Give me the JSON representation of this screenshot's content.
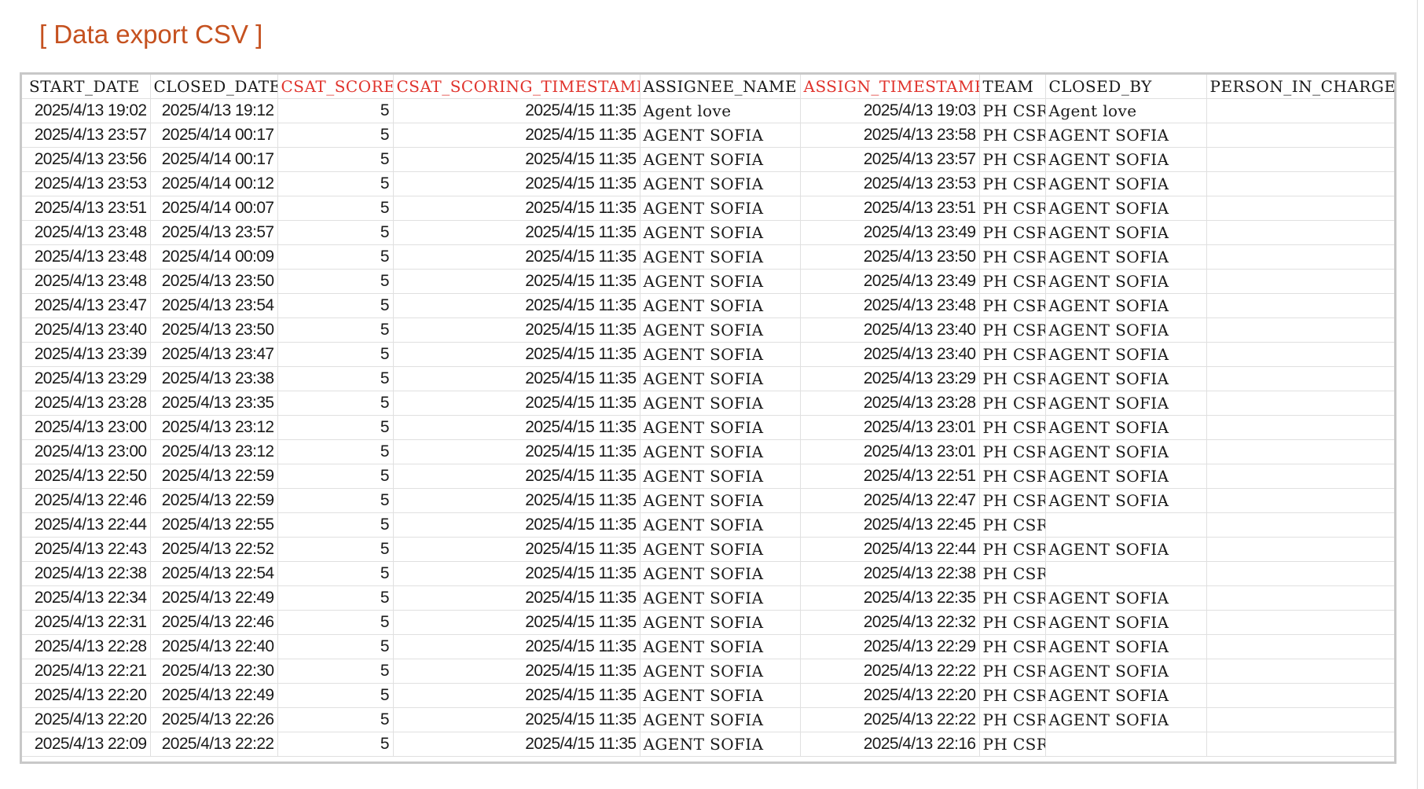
{
  "title": "[ Data export CSV ]",
  "colors": {
    "title": "#c5511f",
    "highlighted_header": "#e0332c",
    "text": "#1a1a1a",
    "grid": "#e0e0e0"
  },
  "table": {
    "columns": [
      {
        "label": "START_DATE",
        "highlighted": false
      },
      {
        "label": "CLOSED_DATE",
        "highlighted": false
      },
      {
        "label": "CSAT_SCORE",
        "highlighted": true
      },
      {
        "label": "CSAT_SCORING_TIMESTAMP",
        "highlighted": true
      },
      {
        "label": "ASSIGNEE_NAME",
        "highlighted": false
      },
      {
        "label": "ASSIGN_TIMESTAMP",
        "highlighted": true
      },
      {
        "label": "TEAM",
        "highlighted": false
      },
      {
        "label": "CLOSED_BY",
        "highlighted": false
      },
      {
        "label": "PERSON_IN_CHARGE",
        "highlighted": false
      }
    ],
    "rows": [
      [
        "2025/4/13 19:02",
        "2025/4/13 19:12",
        "5",
        "2025/4/15 11:35",
        "Agent love",
        "2025/4/13 19:03",
        "PH CSR",
        "Agent love",
        ""
      ],
      [
        "2025/4/13 23:57",
        "2025/4/14 00:17",
        "5",
        "2025/4/15 11:35",
        "AGENT SOFIA",
        "2025/4/13 23:58",
        "PH CSR",
        "AGENT SOFIA",
        ""
      ],
      [
        "2025/4/13 23:56",
        "2025/4/14 00:17",
        "5",
        "2025/4/15 11:35",
        "AGENT SOFIA",
        "2025/4/13 23:57",
        "PH CSR",
        "AGENT SOFIA",
        ""
      ],
      [
        "2025/4/13 23:53",
        "2025/4/14 00:12",
        "5",
        "2025/4/15 11:35",
        "AGENT SOFIA",
        "2025/4/13 23:53",
        "PH CSR",
        "AGENT SOFIA",
        ""
      ],
      [
        "2025/4/13 23:51",
        "2025/4/14 00:07",
        "5",
        "2025/4/15 11:35",
        "AGENT SOFIA",
        "2025/4/13 23:51",
        "PH CSR",
        "AGENT SOFIA",
        ""
      ],
      [
        "2025/4/13 23:48",
        "2025/4/13 23:57",
        "5",
        "2025/4/15 11:35",
        "AGENT SOFIA",
        "2025/4/13 23:49",
        "PH CSR",
        "AGENT SOFIA",
        ""
      ],
      [
        "2025/4/13 23:48",
        "2025/4/14 00:09",
        "5",
        "2025/4/15 11:35",
        "AGENT SOFIA",
        "2025/4/13 23:50",
        "PH CSR",
        "AGENT SOFIA",
        ""
      ],
      [
        "2025/4/13 23:48",
        "2025/4/13 23:50",
        "5",
        "2025/4/15 11:35",
        "AGENT SOFIA",
        "2025/4/13 23:49",
        "PH CSR",
        "AGENT SOFIA",
        ""
      ],
      [
        "2025/4/13 23:47",
        "2025/4/13 23:54",
        "5",
        "2025/4/15 11:35",
        "AGENT SOFIA",
        "2025/4/13 23:48",
        "PH CSR",
        "AGENT SOFIA",
        ""
      ],
      [
        "2025/4/13 23:40",
        "2025/4/13 23:50",
        "5",
        "2025/4/15 11:35",
        "AGENT SOFIA",
        "2025/4/13 23:40",
        "PH CSR",
        "AGENT SOFIA",
        ""
      ],
      [
        "2025/4/13 23:39",
        "2025/4/13 23:47",
        "5",
        "2025/4/15 11:35",
        "AGENT SOFIA",
        "2025/4/13 23:40",
        "PH CSR",
        "AGENT SOFIA",
        ""
      ],
      [
        "2025/4/13 23:29",
        "2025/4/13 23:38",
        "5",
        "2025/4/15 11:35",
        "AGENT SOFIA",
        "2025/4/13 23:29",
        "PH CSR",
        "AGENT SOFIA",
        ""
      ],
      [
        "2025/4/13 23:28",
        "2025/4/13 23:35",
        "5",
        "2025/4/15 11:35",
        "AGENT SOFIA",
        "2025/4/13 23:28",
        "PH CSR",
        "AGENT SOFIA",
        ""
      ],
      [
        "2025/4/13 23:00",
        "2025/4/13 23:12",
        "5",
        "2025/4/15 11:35",
        "AGENT SOFIA",
        "2025/4/13 23:01",
        "PH CSR",
        "AGENT SOFIA",
        ""
      ],
      [
        "2025/4/13 23:00",
        "2025/4/13 23:12",
        "5",
        "2025/4/15 11:35",
        "AGENT SOFIA",
        "2025/4/13 23:01",
        "PH CSR",
        "AGENT SOFIA",
        ""
      ],
      [
        "2025/4/13 22:50",
        "2025/4/13 22:59",
        "5",
        "2025/4/15 11:35",
        "AGENT SOFIA",
        "2025/4/13 22:51",
        "PH CSR",
        "AGENT SOFIA",
        ""
      ],
      [
        "2025/4/13 22:46",
        "2025/4/13 22:59",
        "5",
        "2025/4/15 11:35",
        "AGENT SOFIA",
        "2025/4/13 22:47",
        "PH CSR",
        "AGENT SOFIA",
        ""
      ],
      [
        "2025/4/13 22:44",
        "2025/4/13 22:55",
        "5",
        "2025/4/15 11:35",
        "AGENT SOFIA",
        "2025/4/13 22:45",
        "PH CSR",
        "",
        ""
      ],
      [
        "2025/4/13 22:43",
        "2025/4/13 22:52",
        "5",
        "2025/4/15 11:35",
        "AGENT SOFIA",
        "2025/4/13 22:44",
        "PH CSR",
        "AGENT SOFIA",
        ""
      ],
      [
        "2025/4/13 22:38",
        "2025/4/13 22:54",
        "5",
        "2025/4/15 11:35",
        "AGENT SOFIA",
        "2025/4/13 22:38",
        "PH CSR",
        "",
        ""
      ],
      [
        "2025/4/13 22:34",
        "2025/4/13 22:49",
        "5",
        "2025/4/15 11:35",
        "AGENT SOFIA",
        "2025/4/13 22:35",
        "PH CSR",
        "AGENT SOFIA",
        ""
      ],
      [
        "2025/4/13 22:31",
        "2025/4/13 22:46",
        "5",
        "2025/4/15 11:35",
        "AGENT SOFIA",
        "2025/4/13 22:32",
        "PH CSR",
        "AGENT SOFIA",
        ""
      ],
      [
        "2025/4/13 22:28",
        "2025/4/13 22:40",
        "5",
        "2025/4/15 11:35",
        "AGENT SOFIA",
        "2025/4/13 22:29",
        "PH CSR",
        "AGENT SOFIA",
        ""
      ],
      [
        "2025/4/13 22:21",
        "2025/4/13 22:30",
        "5",
        "2025/4/15 11:35",
        "AGENT SOFIA",
        "2025/4/13 22:22",
        "PH CSR",
        "AGENT SOFIA",
        ""
      ],
      [
        "2025/4/13 22:20",
        "2025/4/13 22:49",
        "5",
        "2025/4/15 11:35",
        "AGENT SOFIA",
        "2025/4/13 22:20",
        "PH CSR",
        "AGENT SOFIA",
        ""
      ],
      [
        "2025/4/13 22:20",
        "2025/4/13 22:26",
        "5",
        "2025/4/15 11:35",
        "AGENT SOFIA",
        "2025/4/13 22:22",
        "PH CSR",
        "AGENT SOFIA",
        ""
      ],
      [
        "2025/4/13 22:09",
        "2025/4/13 22:22",
        "5",
        "2025/4/15 11:35",
        "AGENT SOFIA",
        "2025/4/13 22:16",
        "PH CSR",
        "",
        ""
      ]
    ]
  }
}
